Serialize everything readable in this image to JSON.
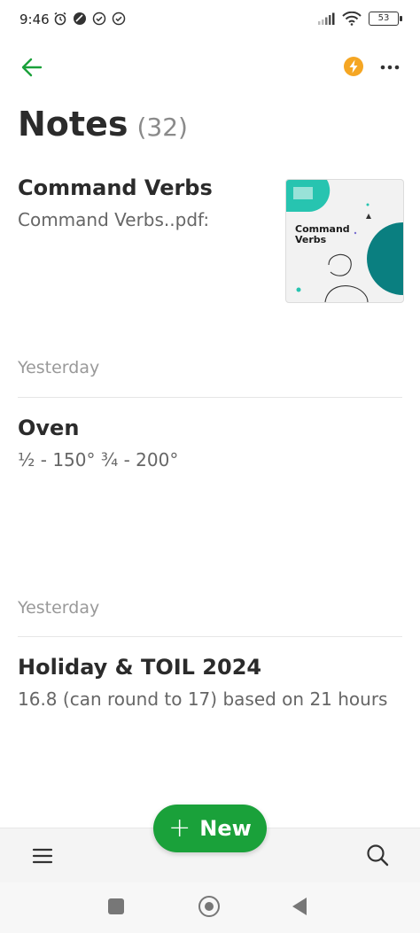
{
  "status_bar": {
    "time": "9:46",
    "battery": "53",
    "icons": [
      "alarm-icon",
      "vpn-icon",
      "check-circle-icon",
      "check-circle-icon",
      "signal-icon",
      "wifi-icon",
      "battery-icon"
    ]
  },
  "top_bar": {
    "back_icon": "arrow-left-icon",
    "upgrade_icon": "bolt-icon",
    "more_icon": "more-horizontal-icon"
  },
  "header": {
    "title": "Notes",
    "count": "(32)"
  },
  "notes": [
    {
      "title": "Command Verbs",
      "snippet": "Command Verbs..pdf:",
      "thumbnail_text_line1": "Command",
      "thumbnail_text_line2": "Verbs"
    },
    {
      "date": "Yesterday",
      "title": "Oven",
      "snippet": "½ - 150° ¾ - 200°"
    },
    {
      "date": "Yesterday",
      "title": "Holiday & TOIL 2024",
      "snippet": "16.8 (can round to 17) based on 21 hours"
    }
  ],
  "new_button": {
    "label": "New"
  },
  "colors": {
    "accent_green": "#1aa13a",
    "upgrade_orange": "#f5a623",
    "thumb_teal": "#0a7f80"
  }
}
